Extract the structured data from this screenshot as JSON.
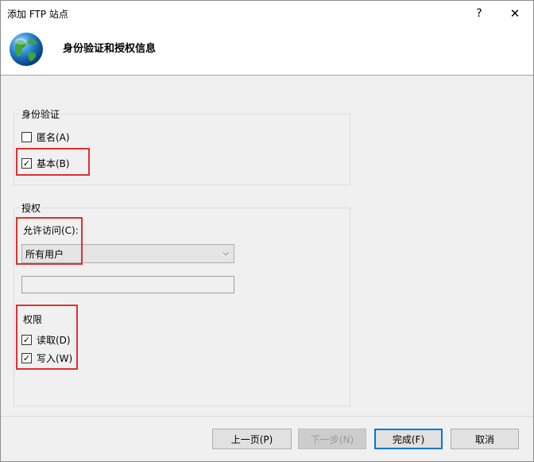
{
  "window": {
    "title": "添加 FTP 站点",
    "help_label": "?",
    "close_label": "✕"
  },
  "header": {
    "title": "身份验证和授权信息"
  },
  "authentication": {
    "group_label": "身份验证",
    "anonymous": {
      "label": "匿名(A)",
      "checked": false
    },
    "basic": {
      "label": "基本(B)",
      "checked": true
    }
  },
  "authorization": {
    "group_label": "授权",
    "allow_access_label": "允许访问(C):",
    "allow_access_value": "所有用户",
    "extra_input_value": "",
    "permissions_label": "权限",
    "read": {
      "label": "读取(D)",
      "checked": true
    },
    "write": {
      "label": "写入(W)",
      "checked": true
    }
  },
  "footer": {
    "prev_label": "上一页(P)",
    "next_label": "下一步(N)",
    "finish_label": "完成(F)",
    "cancel_label": "取消"
  },
  "icons": {
    "checkmark": "✓",
    "chevron": "⌵"
  },
  "colors": {
    "highlight": "#e03030",
    "primary_border": "#0078d7"
  }
}
